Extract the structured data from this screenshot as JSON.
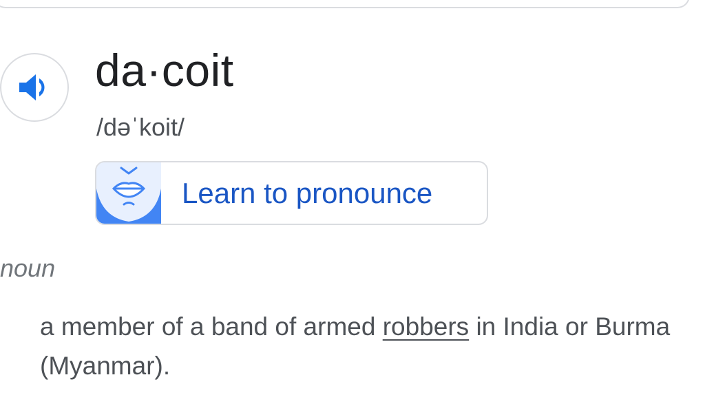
{
  "entry": {
    "word": "da·coit",
    "phonetic": "/dəˈkoit/",
    "speaker_icon": "speaker-icon",
    "learn_button_label": "Learn to pronounce",
    "learn_icon": "mouth-illustration-icon"
  },
  "sense": {
    "part_of_speech": "noun",
    "definition_before": "a member of a band of armed ",
    "definition_link": "robbers",
    "definition_after": " in India or Burma (Myanmar)."
  },
  "colors": {
    "accent": "#1a73e8",
    "link_text": "#1a56c4",
    "border": "#dadce0"
  }
}
